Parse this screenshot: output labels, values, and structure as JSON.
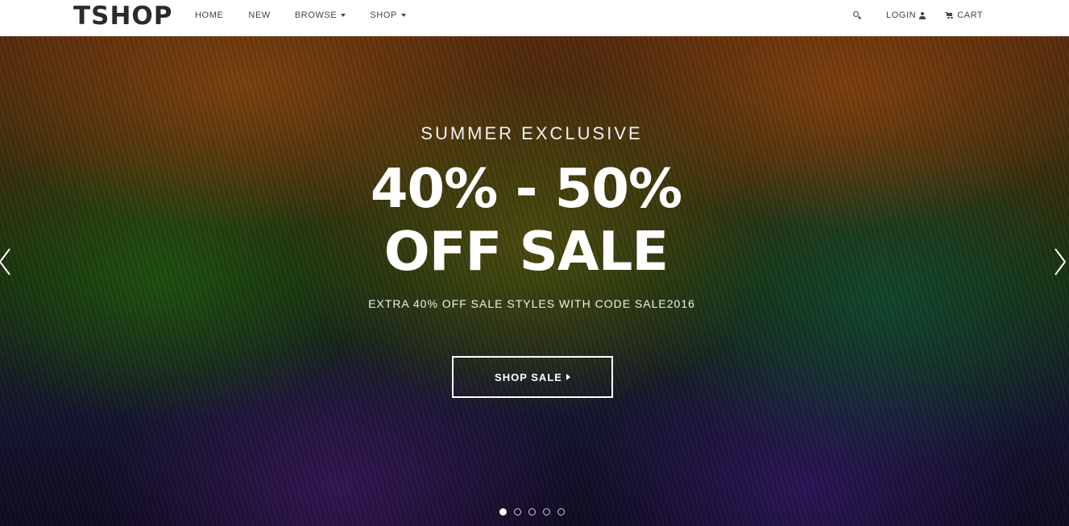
{
  "brand": {
    "logo": "TSHOP"
  },
  "nav": {
    "home": "HOME",
    "new": "NEW",
    "browse": "BROWSE",
    "shop": "SHOP",
    "login": "LOGIN",
    "cart": "CART"
  },
  "hero": {
    "eyebrow": "SUMMER EXCLUSIVE",
    "headline_line1": "40% - 50%",
    "headline_line2": "OFF SALE",
    "subline": "EXTRA 40% OFF SALE STYLES WITH CODE SALE2016",
    "cta_label": "SHOP SALE"
  },
  "slider": {
    "slide_count": 5,
    "active_slide": 1
  },
  "icons": {
    "search": "search-icon",
    "user": "user-icon",
    "cart": "cart-icon",
    "prev": "chevron-left-icon",
    "next": "chevron-right-icon"
  },
  "colors": {
    "topbar_bg": "#ffffff",
    "nav_text": "#444444",
    "logo_text": "#2b2b2b",
    "hero_text": "#ffffff"
  }
}
